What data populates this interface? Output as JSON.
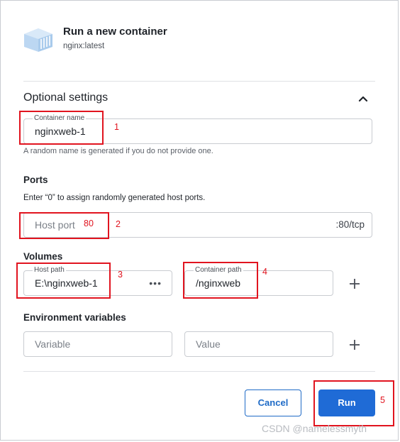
{
  "header": {
    "title": "Run a new container",
    "image": "nginx:latest",
    "logo_icon": "docker-image-icon"
  },
  "optional": {
    "title": "Optional settings",
    "toggle_icon": "chevron-up-icon"
  },
  "container_name": {
    "label": "Container name",
    "value": "nginxweb-1",
    "helper": "A random name is generated if you do not provide one."
  },
  "ports": {
    "title": "Ports",
    "hint": "Enter “0” to assign randomly generated host ports.",
    "host_port_placeholder": "Host port",
    "host_port_value": "80",
    "container_port": ":80/tcp"
  },
  "volumes": {
    "title": "Volumes",
    "host_label": "Host path",
    "host_value": "E:\\nginxweb-1",
    "browse": "•••",
    "container_label": "Container path",
    "container_value": "/nginxweb"
  },
  "env": {
    "title": "Environment variables",
    "variable_placeholder": "Variable",
    "value_placeholder": "Value"
  },
  "buttons": {
    "cancel": "Cancel",
    "run": "Run"
  },
  "annotations": {
    "n1": "1",
    "n2": "2",
    "n3": "3",
    "n4": "4",
    "n5": "5",
    "annotation_color": "#e1141f"
  },
  "watermark": "CSDN @namelessmyth",
  "colors": {
    "primary": "#1f6bd6",
    "border": "#c9ccd1"
  }
}
